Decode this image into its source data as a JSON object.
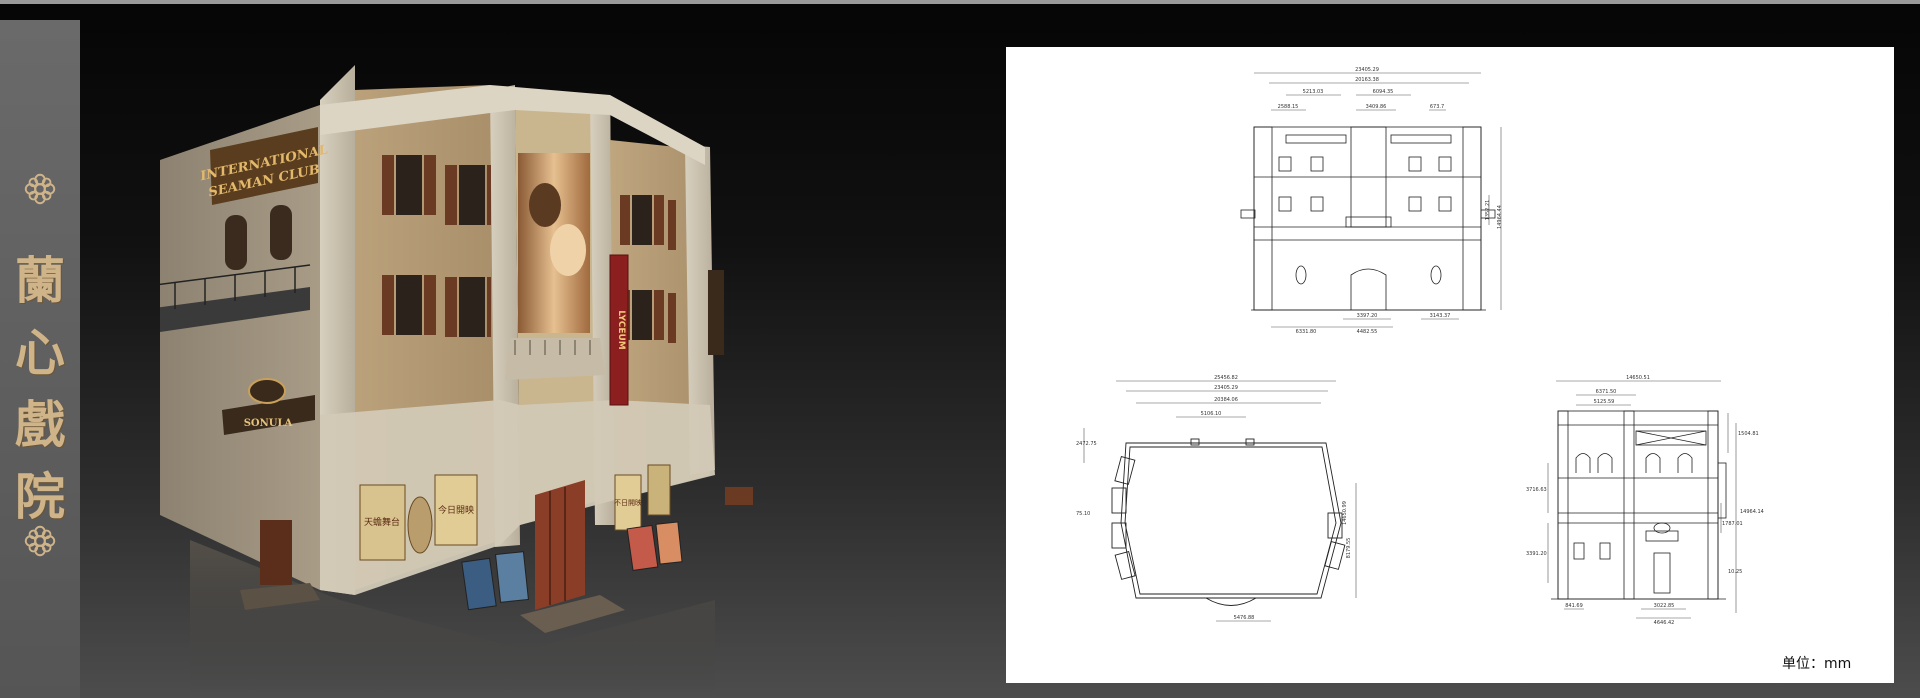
{
  "title": {
    "chars": [
      "蘭",
      "心",
      "戲",
      "院"
    ]
  },
  "building_signs": {
    "club_sign_line1": "INTERNATIONAL",
    "club_sign_line2": "SEAMAN CLUB",
    "lyceum_sign": "LYCEUM",
    "poster_left_text": "天蟾舞台",
    "poster_right_text": "今日開映",
    "poster_side_text": "不日開映",
    "reflected_sign": "SONULA"
  },
  "elevation_front": {
    "dims_top": [
      "23405.29",
      "20163.38",
      "5213.03",
      "6094.35",
      "2588.15",
      "3409.86",
      "673.7"
    ],
    "dims_bottom": [
      "3397.20",
      "6331.80",
      "4482.55",
      "3143.37"
    ],
    "dims_right": [
      "1352.21",
      "14964.44"
    ]
  },
  "plan": {
    "dims_top": [
      "25456.82",
      "23405.29",
      "20384.06",
      "5106.10"
    ],
    "dims_left": [
      "2472.75",
      "75.10"
    ],
    "dims_right": [
      "14650.99",
      "8179.55"
    ],
    "dims_bottom": [
      "5476.88"
    ]
  },
  "elevation_side": {
    "dims_top": [
      "14650.51",
      "6371.50",
      "5125.59"
    ],
    "dims_left": [
      "3716.63",
      "3391.20"
    ],
    "dims_right": [
      "1504.81",
      "14964.14",
      "1787.01",
      "10.25"
    ],
    "dims_bottom": [
      "3022.85",
      "4646.42",
      "841.69"
    ]
  },
  "unit_label": "单位：mm",
  "colors": {
    "sidebar": "#5f5f5f",
    "title_gold": "#cfb48a",
    "stone": "#cfc6b4",
    "brick": "#b9a27c",
    "shutter": "#6b3a22",
    "sheet": "#ffffff"
  }
}
